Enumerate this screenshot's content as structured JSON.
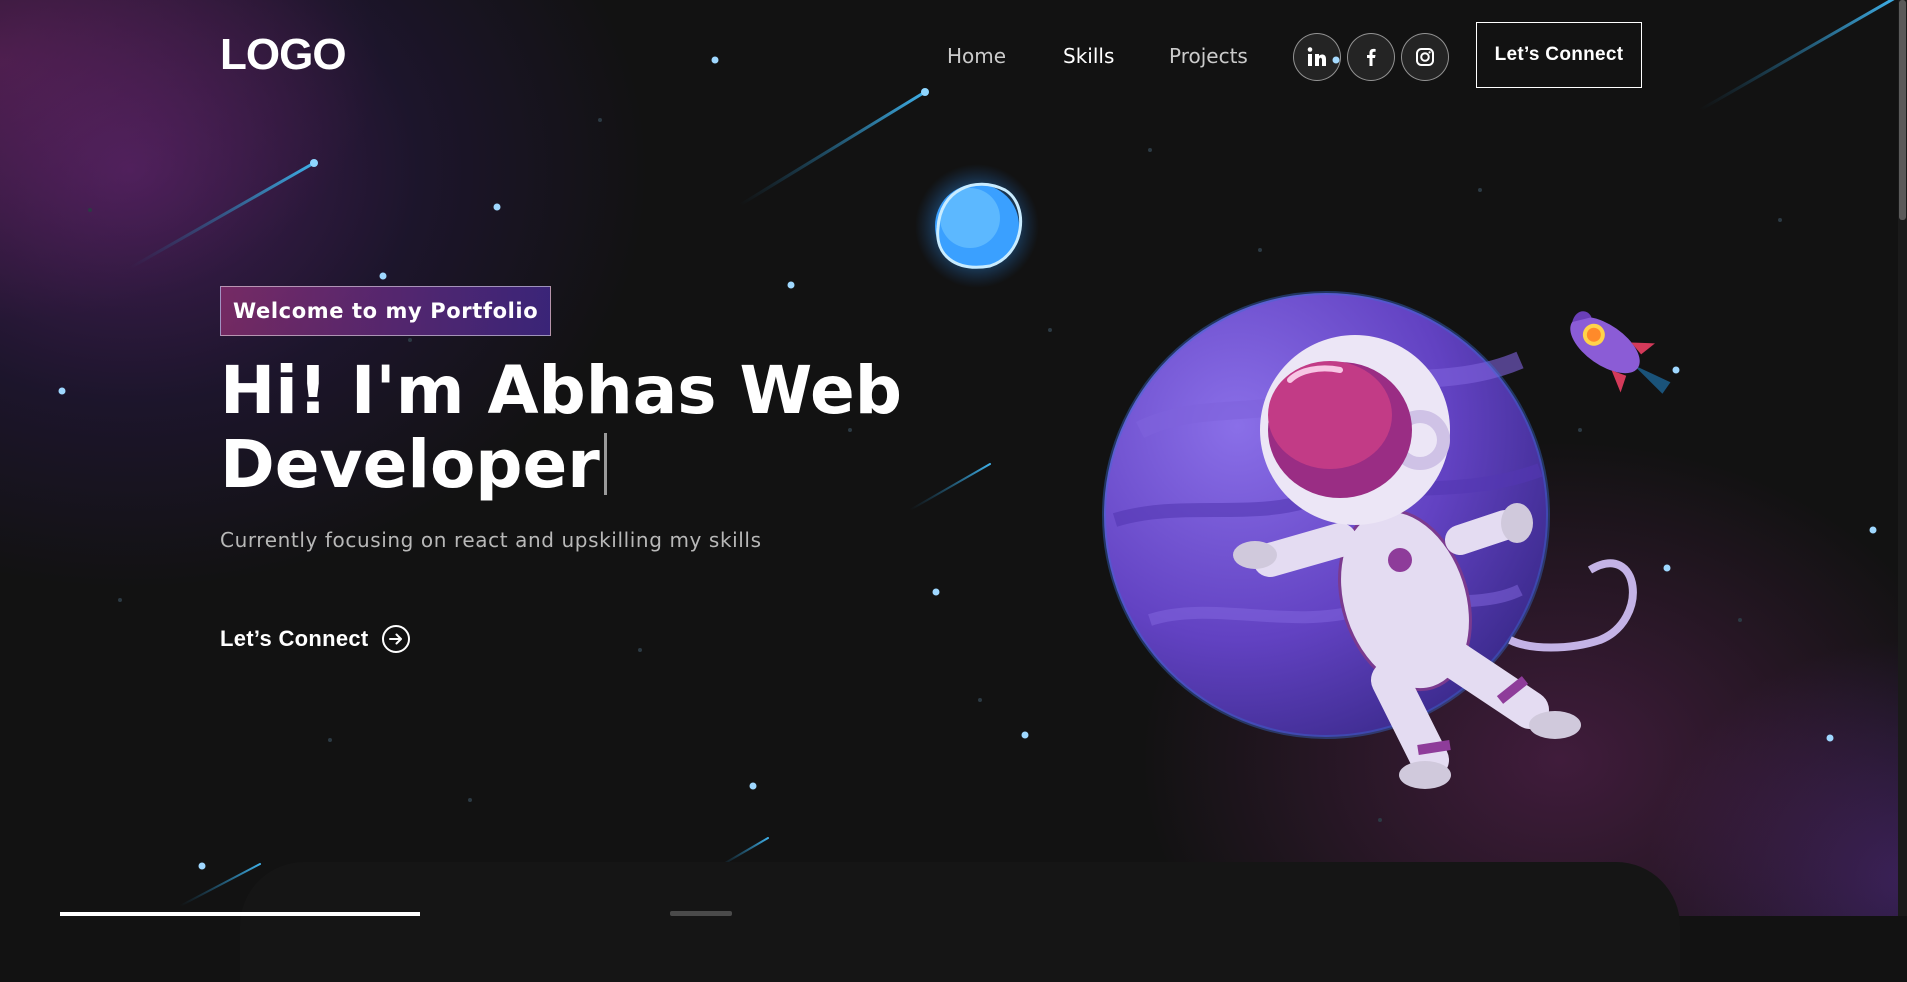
{
  "navbar": {
    "logo_text": "LOGO",
    "links": [
      {
        "label": "Home",
        "active": false
      },
      {
        "label": "Skills",
        "active": true
      },
      {
        "label": "Projects",
        "active": false
      }
    ],
    "social_icons": [
      "linkedin-icon",
      "facebook-icon",
      "instagram-icon"
    ],
    "connect_label": "Let’s Connect"
  },
  "hero": {
    "tagline": "Welcome to my Portfolio",
    "headline_line1": "Hi! I'm Abhas Web",
    "headline_line2": "Developer",
    "subtitle": "Currently focusing on react and upskilling my skills",
    "cta_label": "Let’s Connect"
  },
  "colors": {
    "background": "#121212",
    "planet": "#6b49c9",
    "tagline_gradient_start": "#aa367c",
    "tagline_gradient_end": "#4a2fbd",
    "star": "#9fd8ff"
  }
}
